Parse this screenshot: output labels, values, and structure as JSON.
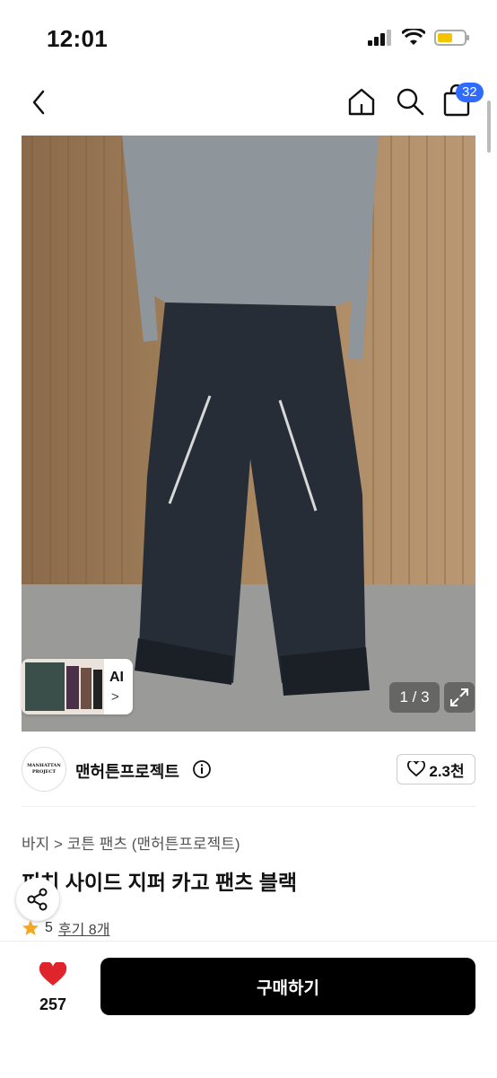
{
  "status_bar": {
    "time": "12:01"
  },
  "nav": {
    "cart_count": "32"
  },
  "gallery": {
    "ai_label": "AI",
    "ai_chevron": ">",
    "counter": "1 / 3"
  },
  "brand": {
    "name": "맨허튼프로젝트",
    "logo_line1": "MANHATTAN",
    "logo_line2": "PROJECT",
    "likes": "2.3천"
  },
  "product": {
    "breadcrumb_1": "바지",
    "breadcrumb_sep": ">",
    "breadcrumb_2": "코튼 팬츠 (맨허튼프로젝트)",
    "title": "피치 사이드 지퍼 카고 팬츠 블랙",
    "rating": "5",
    "reviews": "후기 8개"
  },
  "bottom": {
    "wish_count": "257",
    "buy_label": "구매하기"
  },
  "colors": {
    "accent": "#2f6bff",
    "heart": "#e0242b",
    "star": "#f5a623",
    "buy_bg": "#000000"
  }
}
